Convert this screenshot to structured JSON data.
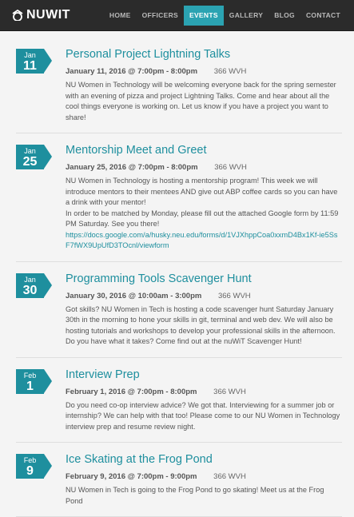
{
  "brand": {
    "logo_text": "NUWIT"
  },
  "nav": {
    "items": [
      {
        "label": "HOME"
      },
      {
        "label": "OFFICERS"
      },
      {
        "label": "EVENTS"
      },
      {
        "label": "GALLERY"
      },
      {
        "label": "BLOG"
      },
      {
        "label": "CONTACT"
      }
    ],
    "active": "EVENTS"
  },
  "colors": {
    "accent": "#1e8f9e",
    "nav_bg": "#2b2b2b",
    "active_nav": "#2ba3b2"
  },
  "events": [
    {
      "month": "Jan",
      "day": "11",
      "title": "Personal Project Lightning Talks",
      "when": "January 11, 2016 @ 7:00pm - 8:00pm",
      "where": "366 WVH",
      "desc": [
        "NU Women in Technology will be welcoming everyone back for the spring semester with an evening of pizza and project Lightning Talks. Come and hear about all the cool things everyone is working on. Let us know if you have a project you want to share!"
      ],
      "link": ""
    },
    {
      "month": "Jan",
      "day": "25",
      "title": "Mentorship Meet and Greet",
      "when": "January 25, 2016 @ 7:00pm - 8:00pm",
      "where": "366 WVH",
      "desc": [
        "NU Women in Technology is hosting a mentorship program! This week we will introduce mentors to their mentees AND give out ABP coffee cards so you can have a drink with your mentor!",
        "In order to be matched by Monday, please fill out the attached Google form by 11:59 PM Saturday. See you there!"
      ],
      "link": "https://docs.google.com/a/husky.neu.edu/forms/d/1VJXhppCoa0xxmD4Bx1Kf-ie5SsF7fWX9UpUfD3TOcnl/viewform"
    },
    {
      "month": "Jan",
      "day": "30",
      "title": "Programming Tools Scavenger Hunt",
      "when": "January 30, 2016 @ 10:00am - 3:00pm",
      "where": "366 WVH",
      "desc": [
        "Got skills? NU Women in Tech is hosting a code scavenger hunt Saturday January 30th in the morning to hone your skills in git, terminal and web dev. We will also be hosting tutorials and workshops to develop your professional skills in the afternoon. Do you have what it takes? Come find out at the nuWiT Scavenger Hunt!"
      ],
      "link": ""
    },
    {
      "month": "Feb",
      "day": "1",
      "title": "Interview Prep",
      "when": "February 1, 2016 @ 7:00pm - 8:00pm",
      "where": "366 WVH",
      "desc": [
        "Do you need co-op interview advice? We got that. Interviewing for a summer job or internship? We can help with that too! Please come to our NU Women in Technology interview prep and resume review night."
      ],
      "link": ""
    },
    {
      "month": "Feb",
      "day": "9",
      "title": "Ice Skating at the Frog Pond",
      "when": "February 9, 2016 @ 7:00pm - 9:00pm",
      "where": "366 WVH",
      "desc": [
        "NU Women in Tech is going to the Frog Pond to go skating! Meet us at the Frog Pond"
      ],
      "link": ""
    }
  ]
}
